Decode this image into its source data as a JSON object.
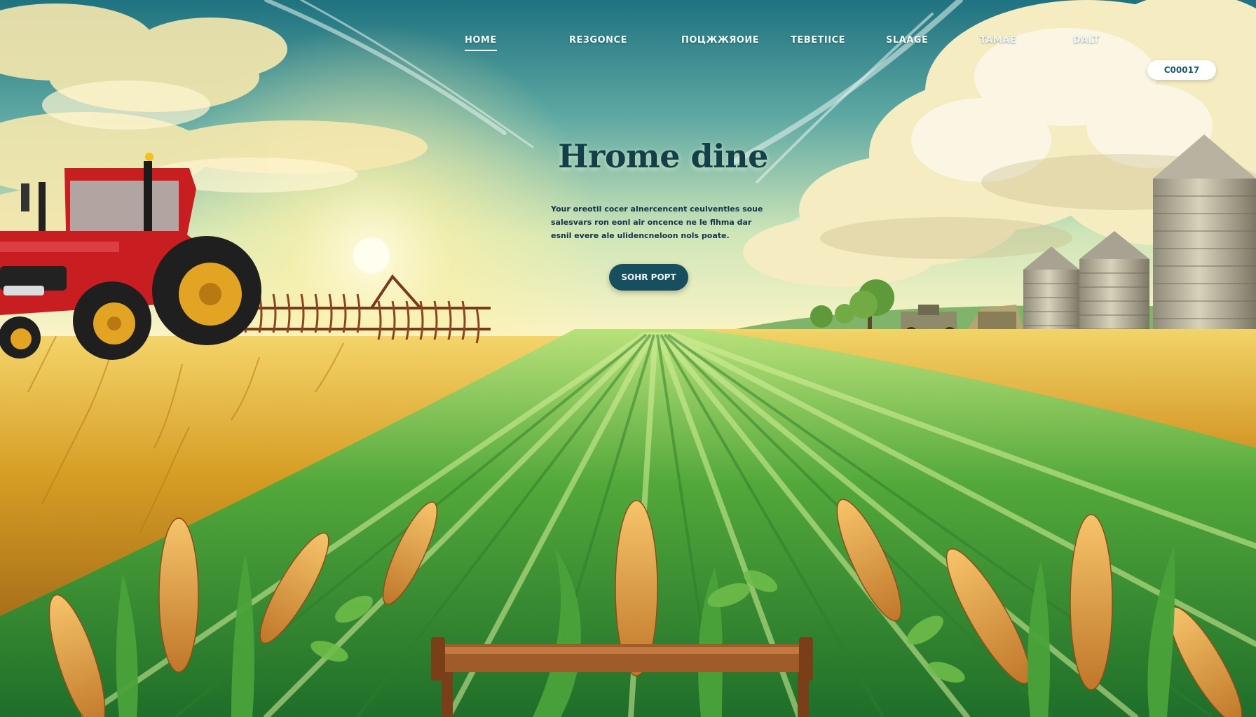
{
  "nav": {
    "items": [
      {
        "label": "HOME",
        "active": true
      },
      {
        "label": "RE3GONCE"
      },
      {
        "label": "ПОЦЖЖЯОИЕ"
      },
      {
        "label": "TEBETIICE"
      },
      {
        "label": "SLAAGE"
      },
      {
        "label": "TAMAE"
      },
      {
        "label": "DALT"
      }
    ],
    "cta_label": "C00017"
  },
  "hero": {
    "title": "Hrome dine",
    "subtitle": "Your oreotil cocer alnercencent ceulventles soue salesvars ron eonl air oncence ne le fihma dar esnil evere ale ulidencneloon nols poate.",
    "button_label": "SOHR POPT"
  },
  "colors": {
    "sky_top": "#2a7f8a",
    "sky_horizon": "#f7f2b8",
    "field_green": "#3f9a2c",
    "wheat_gold": "#d9a52b",
    "tractor_red": "#c81e22",
    "button_dark": "#174f5f"
  },
  "icons": [
    "tractor-illustration",
    "silo-illustration",
    "wheat-illustration",
    "sun-illustration",
    "cloud-illustration"
  ]
}
